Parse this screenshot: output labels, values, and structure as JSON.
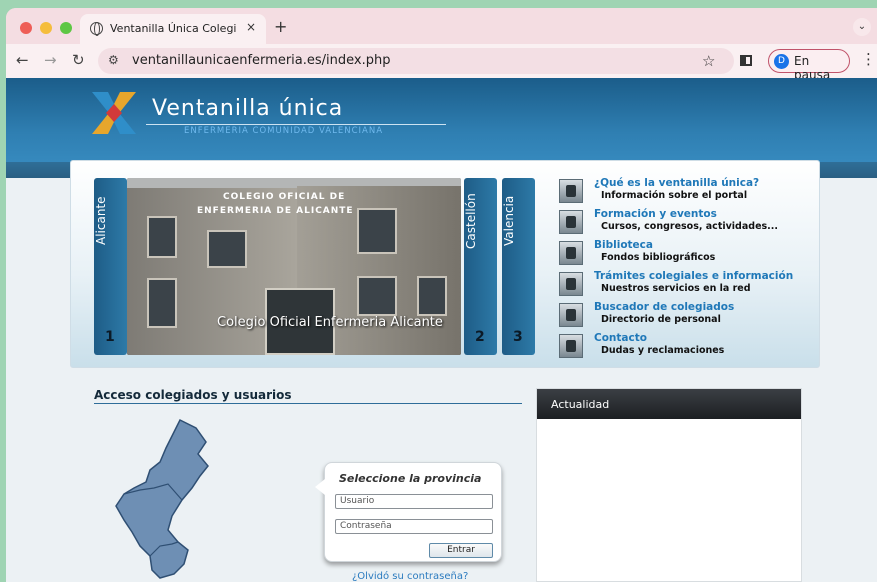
{
  "browser": {
    "tab_title": "Ventanilla Única Colegio Enfer",
    "tab_close": "×",
    "new_tab": "+",
    "url": "ventanillaunicaenfermeria.es/index.php",
    "profile_initial": "D",
    "profile_label": "En pausa",
    "icons": [
      "back-icon",
      "forward-icon",
      "reload-icon",
      "site-settings-icon",
      "bookmark-star-icon",
      "side-panel-icon",
      "menu-icon"
    ]
  },
  "header": {
    "brand": "Ventanilla única",
    "brand_sub": "ENFERMERIA COMUNIDAD VALENCIANA"
  },
  "slider": {
    "tabs": [
      {
        "name": "Alicante",
        "num": "1"
      },
      {
        "name": "Castellón",
        "num": "2"
      },
      {
        "name": "Valencia",
        "num": "3"
      }
    ],
    "photo_sign_1": "COLEGIO OFICIAL DE",
    "photo_sign_2": "ENFERMERIA DE ALICANTE",
    "caption": "Colegio Oficial Enfermeria Alicante"
  },
  "links": [
    {
      "title": "¿Qué es la ventanilla única?",
      "sub": "Información sobre el portal"
    },
    {
      "title": "Formación y eventos",
      "sub": "Cursos, congresos, actividades..."
    },
    {
      "title": "Biblioteca",
      "sub": "Fondos bibliográficos"
    },
    {
      "title": "Trámites colegiales e información",
      "sub": "Nuestros servicios en la red"
    },
    {
      "title": "Buscador de colegiados",
      "sub": "Directorio de personal"
    },
    {
      "title": "Contacto",
      "sub": "Dudas y reclamaciones"
    }
  ],
  "access": {
    "title": "Acceso colegiados y usuarios",
    "login_title": "Seleccione la provincia",
    "user_placeholder": "Usuario",
    "pass_placeholder": "Contraseña",
    "submit": "Entrar",
    "forgot": "¿Olvidó su contraseña?"
  },
  "news": {
    "title": "Actualidad"
  },
  "colors": {
    "header_blue": "#2f7fb2",
    "link_blue": "#1f78b8",
    "slide_tab": "#1e5c86"
  }
}
